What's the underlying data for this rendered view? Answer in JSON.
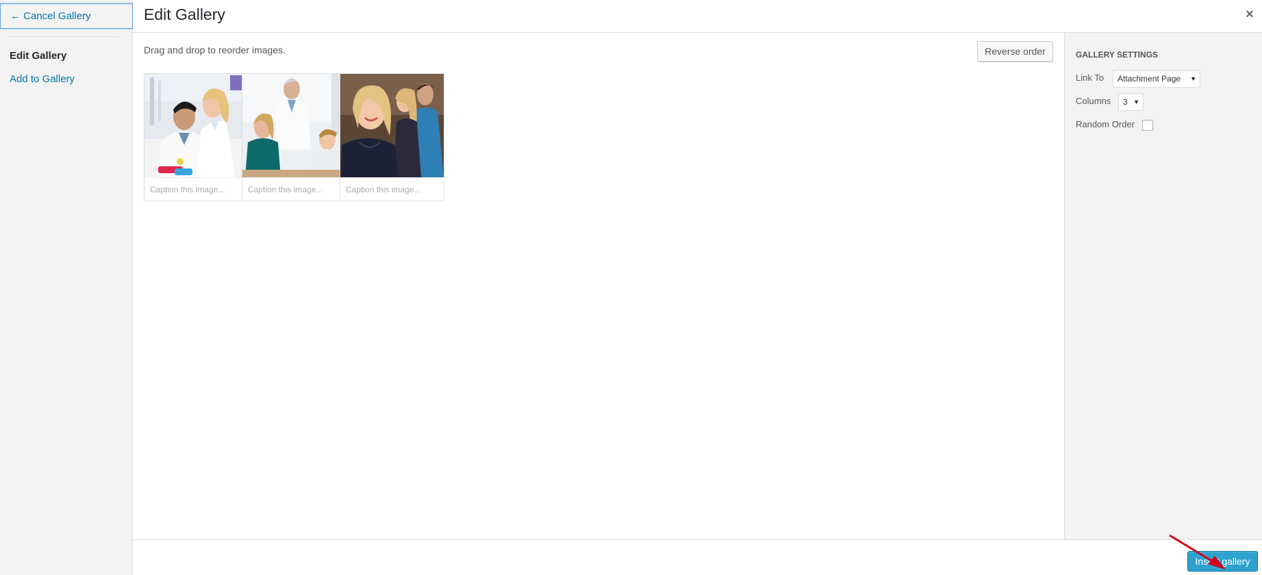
{
  "menu": {
    "cancel_label": "← Cancel Gallery",
    "items": [
      {
        "label": "Edit Gallery",
        "active": true
      },
      {
        "label": "Add to Gallery",
        "active": false
      }
    ]
  },
  "title": "Edit Gallery",
  "close_icon": "×",
  "content": {
    "instructions": "Drag and drop to reorder images.",
    "reverse_label": "Reverse order",
    "images": [
      {
        "subject": "scientists-in-lab",
        "caption_placeholder": "Caption this image..."
      },
      {
        "subject": "doctor-with-students",
        "caption_placeholder": "Caption this image..."
      },
      {
        "subject": "smiling-students",
        "caption_placeholder": "Caption this image..."
      }
    ]
  },
  "settings": {
    "title": "Gallery Settings",
    "link_to_label": "Link To",
    "link_to_value": "Attachment Page",
    "columns_label": "Columns",
    "columns_value": "3",
    "random_order_label": "Random Order",
    "random_order_checked": false
  },
  "toolbar": {
    "insert_label": "Insert gallery"
  },
  "colors": {
    "accent": "#2ea2cc",
    "link": "#0073aa",
    "annotation_arrow": "#d0021b"
  }
}
